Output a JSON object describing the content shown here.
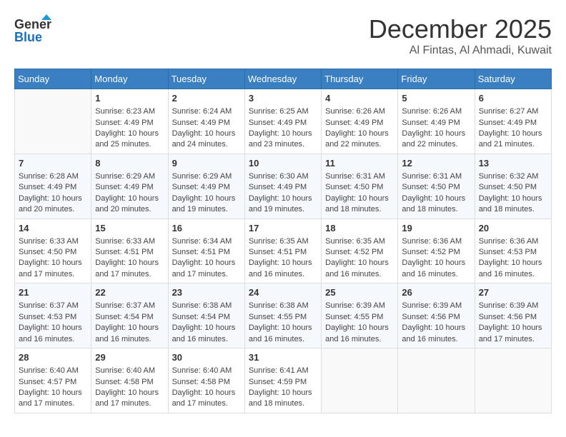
{
  "header": {
    "logo_line1": "General",
    "logo_line2": "Blue",
    "month": "December 2025",
    "location": "Al Fintas, Al Ahmadi, Kuwait"
  },
  "days_of_week": [
    "Sunday",
    "Monday",
    "Tuesday",
    "Wednesday",
    "Thursday",
    "Friday",
    "Saturday"
  ],
  "weeks": [
    [
      {
        "day": "",
        "info": ""
      },
      {
        "day": "1",
        "info": "Sunrise: 6:23 AM\nSunset: 4:49 PM\nDaylight: 10 hours\nand 25 minutes."
      },
      {
        "day": "2",
        "info": "Sunrise: 6:24 AM\nSunset: 4:49 PM\nDaylight: 10 hours\nand 24 minutes."
      },
      {
        "day": "3",
        "info": "Sunrise: 6:25 AM\nSunset: 4:49 PM\nDaylight: 10 hours\nand 23 minutes."
      },
      {
        "day": "4",
        "info": "Sunrise: 6:26 AM\nSunset: 4:49 PM\nDaylight: 10 hours\nand 22 minutes."
      },
      {
        "day": "5",
        "info": "Sunrise: 6:26 AM\nSunset: 4:49 PM\nDaylight: 10 hours\nand 22 minutes."
      },
      {
        "day": "6",
        "info": "Sunrise: 6:27 AM\nSunset: 4:49 PM\nDaylight: 10 hours\nand 21 minutes."
      }
    ],
    [
      {
        "day": "7",
        "info": "Sunrise: 6:28 AM\nSunset: 4:49 PM\nDaylight: 10 hours\nand 20 minutes."
      },
      {
        "day": "8",
        "info": "Sunrise: 6:29 AM\nSunset: 4:49 PM\nDaylight: 10 hours\nand 20 minutes."
      },
      {
        "day": "9",
        "info": "Sunrise: 6:29 AM\nSunset: 4:49 PM\nDaylight: 10 hours\nand 19 minutes."
      },
      {
        "day": "10",
        "info": "Sunrise: 6:30 AM\nSunset: 4:49 PM\nDaylight: 10 hours\nand 19 minutes."
      },
      {
        "day": "11",
        "info": "Sunrise: 6:31 AM\nSunset: 4:50 PM\nDaylight: 10 hours\nand 18 minutes."
      },
      {
        "day": "12",
        "info": "Sunrise: 6:31 AM\nSunset: 4:50 PM\nDaylight: 10 hours\nand 18 minutes."
      },
      {
        "day": "13",
        "info": "Sunrise: 6:32 AM\nSunset: 4:50 PM\nDaylight: 10 hours\nand 18 minutes."
      }
    ],
    [
      {
        "day": "14",
        "info": "Sunrise: 6:33 AM\nSunset: 4:50 PM\nDaylight: 10 hours\nand 17 minutes."
      },
      {
        "day": "15",
        "info": "Sunrise: 6:33 AM\nSunset: 4:51 PM\nDaylight: 10 hours\nand 17 minutes."
      },
      {
        "day": "16",
        "info": "Sunrise: 6:34 AM\nSunset: 4:51 PM\nDaylight: 10 hours\nand 17 minutes."
      },
      {
        "day": "17",
        "info": "Sunrise: 6:35 AM\nSunset: 4:51 PM\nDaylight: 10 hours\nand 16 minutes."
      },
      {
        "day": "18",
        "info": "Sunrise: 6:35 AM\nSunset: 4:52 PM\nDaylight: 10 hours\nand 16 minutes."
      },
      {
        "day": "19",
        "info": "Sunrise: 6:36 AM\nSunset: 4:52 PM\nDaylight: 10 hours\nand 16 minutes."
      },
      {
        "day": "20",
        "info": "Sunrise: 6:36 AM\nSunset: 4:53 PM\nDaylight: 10 hours\nand 16 minutes."
      }
    ],
    [
      {
        "day": "21",
        "info": "Sunrise: 6:37 AM\nSunset: 4:53 PM\nDaylight: 10 hours\nand 16 minutes."
      },
      {
        "day": "22",
        "info": "Sunrise: 6:37 AM\nSunset: 4:54 PM\nDaylight: 10 hours\nand 16 minutes."
      },
      {
        "day": "23",
        "info": "Sunrise: 6:38 AM\nSunset: 4:54 PM\nDaylight: 10 hours\nand 16 minutes."
      },
      {
        "day": "24",
        "info": "Sunrise: 6:38 AM\nSunset: 4:55 PM\nDaylight: 10 hours\nand 16 minutes."
      },
      {
        "day": "25",
        "info": "Sunrise: 6:39 AM\nSunset: 4:55 PM\nDaylight: 10 hours\nand 16 minutes."
      },
      {
        "day": "26",
        "info": "Sunrise: 6:39 AM\nSunset: 4:56 PM\nDaylight: 10 hours\nand 16 minutes."
      },
      {
        "day": "27",
        "info": "Sunrise: 6:39 AM\nSunset: 4:56 PM\nDaylight: 10 hours\nand 17 minutes."
      }
    ],
    [
      {
        "day": "28",
        "info": "Sunrise: 6:40 AM\nSunset: 4:57 PM\nDaylight: 10 hours\nand 17 minutes."
      },
      {
        "day": "29",
        "info": "Sunrise: 6:40 AM\nSunset: 4:58 PM\nDaylight: 10 hours\nand 17 minutes."
      },
      {
        "day": "30",
        "info": "Sunrise: 6:40 AM\nSunset: 4:58 PM\nDaylight: 10 hours\nand 17 minutes."
      },
      {
        "day": "31",
        "info": "Sunrise: 6:41 AM\nSunset: 4:59 PM\nDaylight: 10 hours\nand 18 minutes."
      },
      {
        "day": "",
        "info": ""
      },
      {
        "day": "",
        "info": ""
      },
      {
        "day": "",
        "info": ""
      }
    ]
  ]
}
